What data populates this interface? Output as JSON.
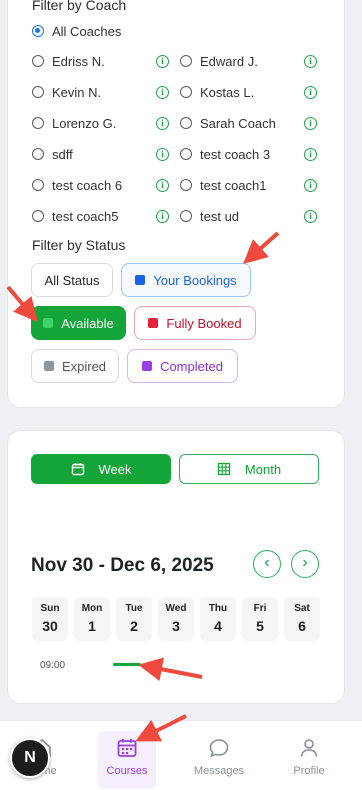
{
  "filter": {
    "coach_title": "Filter by Coach",
    "all_coaches": "All Coaches",
    "coaches": [
      {
        "left": "Edriss N.",
        "right": "Edward J."
      },
      {
        "left": "Kevin N.",
        "right": "Kostas L."
      },
      {
        "left": "Lorenzo G.",
        "right": "Sarah Coach"
      },
      {
        "left": "sdff",
        "right": "test coach 3"
      },
      {
        "left": "test coach 6",
        "right": "test coach1"
      },
      {
        "left": "test coach5",
        "right": "test ud"
      }
    ],
    "info_glyph": "i",
    "status_title": "Filter by Status",
    "statuses": {
      "all": "All Status",
      "your_bookings": "Your Bookings",
      "available": "Available",
      "fully_booked": "Fully Booked",
      "expired": "Expired",
      "completed": "Completed"
    },
    "colors": {
      "accent_green": "#13a538",
      "your_bookings_blue": "#1a63e8",
      "fully_booked_red": "#e5223b",
      "expired_gray": "#8e96a3",
      "completed_purple": "#9b3ee6"
    }
  },
  "calendar": {
    "week_label": "Week",
    "month_label": "Month",
    "range_title": "Nov 30 - Dec 6, 2025",
    "prev_glyph": "‹",
    "next_glyph": "›",
    "days": [
      {
        "name": "Sun",
        "date": "30"
      },
      {
        "name": "Mon",
        "date": "1"
      },
      {
        "name": "Tue",
        "date": "2"
      },
      {
        "name": "Wed",
        "date": "3"
      },
      {
        "name": "Thu",
        "date": "4"
      },
      {
        "name": "Fri",
        "date": "5"
      },
      {
        "name": "Sat",
        "date": "6"
      }
    ],
    "time_label": "09:00"
  },
  "nav": {
    "home": "Home",
    "courses": "Courses",
    "messages": "Messages",
    "profile": "Profile",
    "avatar_letter": "N",
    "active_color": "#9b3ee6"
  },
  "annotation_color": "#f04a3e"
}
